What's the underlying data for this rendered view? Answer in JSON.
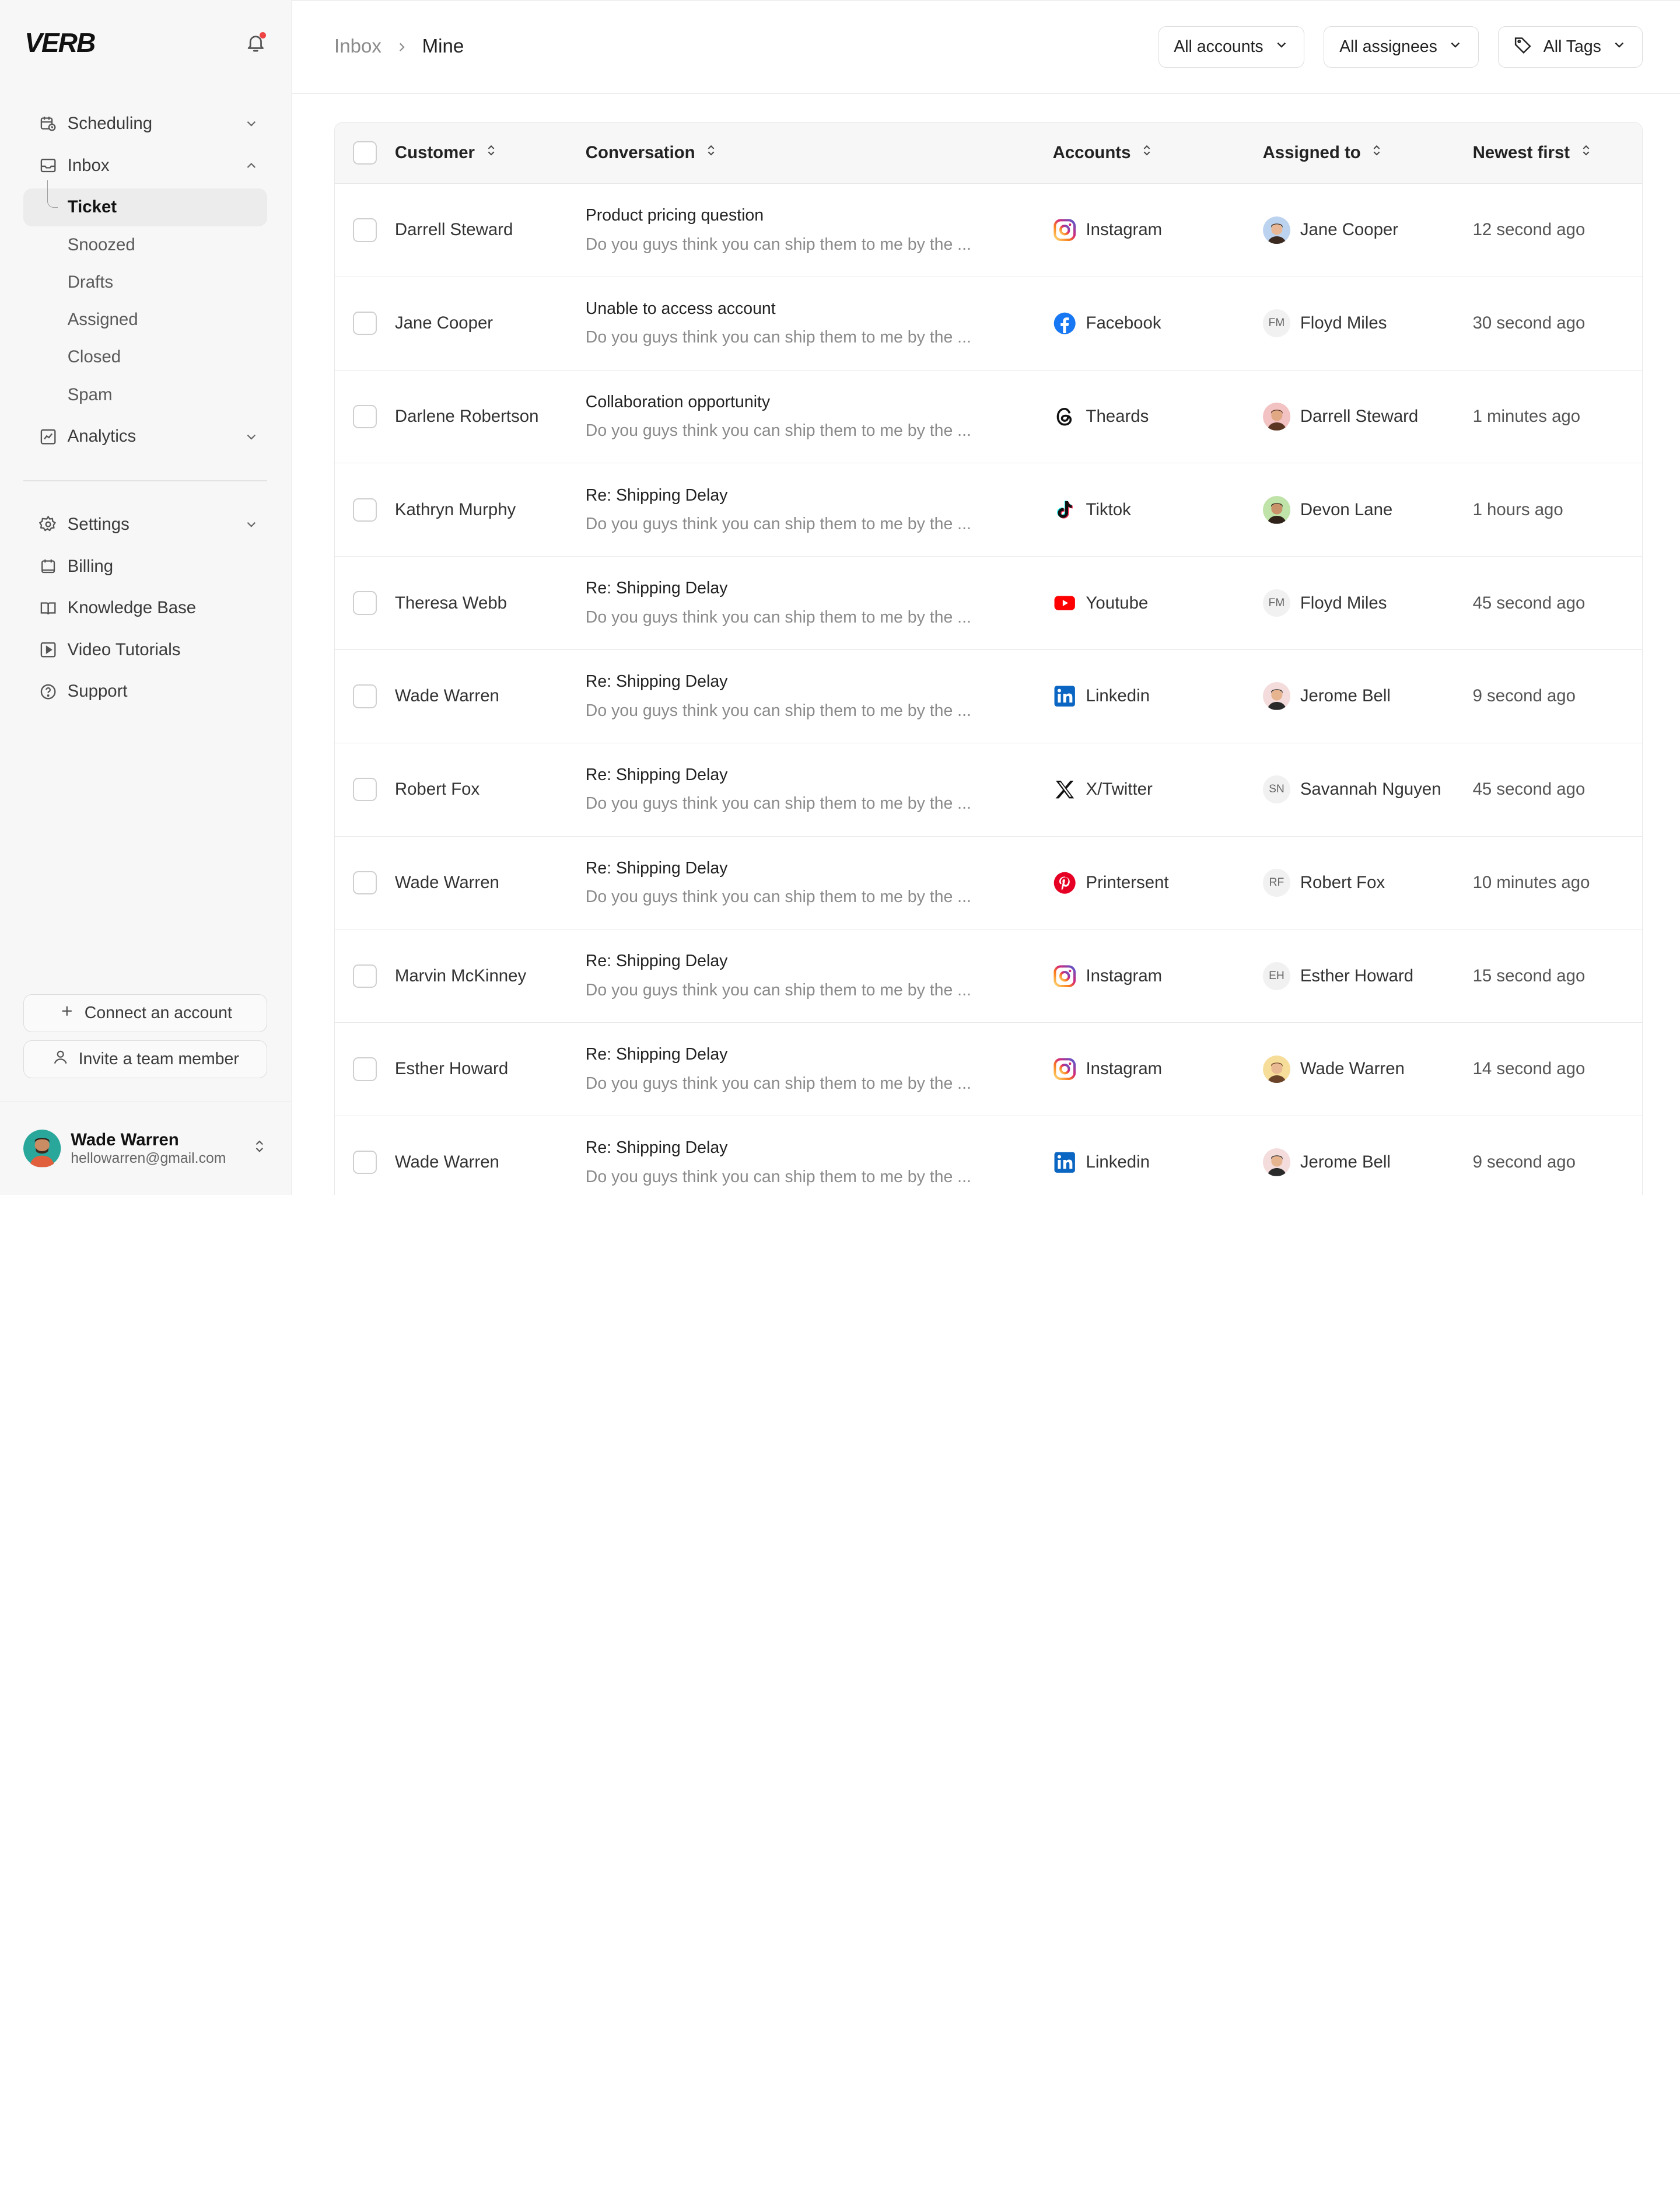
{
  "app": {
    "logo": "VERB"
  },
  "sidebar": {
    "nav": [
      {
        "label": "Scheduling",
        "icon": "calendar-clock-icon",
        "expanded": false
      },
      {
        "label": "Inbox",
        "icon": "inbox-icon",
        "expanded": true
      },
      {
        "label": "Analytics",
        "icon": "chart-icon",
        "expanded": false
      }
    ],
    "inbox_sub": [
      "Ticket",
      "Snoozed",
      "Drafts",
      "Assigned",
      "Closed",
      "Spam"
    ],
    "active_sub": "Ticket",
    "secondary": [
      {
        "label": "Settings",
        "icon": "gear-icon",
        "has_chevron": true
      },
      {
        "label": "Billing",
        "icon": "billing-icon",
        "has_chevron": false
      },
      {
        "label": "Knowledge Base",
        "icon": "book-icon",
        "has_chevron": false
      },
      {
        "label": "Video Tutorials",
        "icon": "video-icon",
        "has_chevron": false
      },
      {
        "label": "Support",
        "icon": "help-icon",
        "has_chevron": false
      }
    ],
    "connect_label": "Connect an account",
    "invite_label": "Invite a team member",
    "user": {
      "name": "Wade Warren",
      "email": "hellowarren@gmail.com"
    }
  },
  "breadcrumb": {
    "parent": "Inbox",
    "current": "Mine"
  },
  "filters": {
    "accounts": "All accounts",
    "assignees": "All assignees",
    "tags": "All Tags"
  },
  "table": {
    "headers": {
      "customer": "Customer",
      "conversation": "Conversation",
      "accounts": "Accounts",
      "assigned": "Assigned to",
      "sort": "Newest first"
    },
    "rows": [
      {
        "customer": "Darrell Steward",
        "title": "Product pricing question",
        "preview": "Do you guys think you can ship them to me by the ...",
        "account": "Instagram",
        "account_icon": "instagram",
        "assignee": "Jane Cooper",
        "avatar": {
          "type": "photo",
          "bg": "#bcd3ef",
          "skin": "#e8b896",
          "hair": "#3a2a20"
        },
        "time": "12 second ago"
      },
      {
        "customer": "Jane Cooper",
        "title": "Unable to access account",
        "preview": "Do you guys think you can ship them to me by the ...",
        "account": "Facebook",
        "account_icon": "facebook",
        "assignee": "Floyd Miles",
        "avatar": {
          "type": "initials",
          "text": "FM"
        },
        "time": "30 second ago"
      },
      {
        "customer": "Darlene Robertson",
        "title": "Collaboration opportunity",
        "preview": "Do you guys think you can ship them to me by the ...",
        "account": "Theards",
        "account_icon": "threads",
        "assignee": "Darrell Steward",
        "avatar": {
          "type": "photo",
          "bg": "#f3c2c2",
          "skin": "#e0a883",
          "hair": "#5a3522"
        },
        "time": "1 minutes ago"
      },
      {
        "customer": "Kathryn Murphy",
        "title": "Re: Shipping Delay",
        "preview": "Do you guys think you can ship them to me by the ...",
        "account": "Tiktok",
        "account_icon": "tiktok",
        "assignee": "Devon Lane",
        "avatar": {
          "type": "photo",
          "bg": "#bfe3a8",
          "skin": "#c8926a",
          "hair": "#2e2219"
        },
        "time": "1 hours ago"
      },
      {
        "customer": "Theresa Webb",
        "title": "Re: Shipping Delay",
        "preview": "Do you guys think you can ship them to me by the ...",
        "account": "Youtube",
        "account_icon": "youtube",
        "assignee": "Floyd Miles",
        "avatar": {
          "type": "initials",
          "text": "FM"
        },
        "time": "45 second ago"
      },
      {
        "customer": "Wade Warren",
        "title": "Re: Shipping Delay",
        "preview": "Do you guys think you can ship them to me by the ...",
        "account": "Linkedin",
        "account_icon": "linkedin",
        "assignee": "Jerome Bell",
        "avatar": {
          "type": "photo",
          "bg": "#f4dcdc",
          "skin": "#e6b48f",
          "hair": "#2a2a2a"
        },
        "time": "9 second ago"
      },
      {
        "customer": "Robert Fox",
        "title": "Re: Shipping Delay",
        "preview": "Do you guys think you can ship them to me by the ...",
        "account": "X/Twitter",
        "account_icon": "x",
        "assignee": "Savannah Nguyen",
        "avatar": {
          "type": "initials",
          "text": "SN"
        },
        "time": "45 second ago"
      },
      {
        "customer": "Wade Warren",
        "title": "Re: Shipping Delay",
        "preview": "Do you guys think you can ship them to me by the ...",
        "account": "Printersent",
        "account_icon": "pinterest",
        "assignee": "Robert Fox",
        "avatar": {
          "type": "initials",
          "text": "RF"
        },
        "time": "10 minutes ago"
      },
      {
        "customer": "Marvin McKinney",
        "title": "Re: Shipping Delay",
        "preview": "Do you guys think you can ship them to me by the ...",
        "account": "Instagram",
        "account_icon": "instagram",
        "assignee": "Esther Howard",
        "avatar": {
          "type": "initials",
          "text": "EH"
        },
        "time": "15 second ago"
      },
      {
        "customer": "Esther Howard",
        "title": "Re: Shipping Delay",
        "preview": "Do you guys think you can ship them to me by the ...",
        "account": "Instagram",
        "account_icon": "instagram",
        "assignee": "Wade Warren",
        "avatar": {
          "type": "photo",
          "bg": "#f7dd9a",
          "skin": "#e9b993",
          "hair": "#6a4328"
        },
        "time": "14 second ago"
      },
      {
        "customer": "Wade Warren",
        "title": "Re: Shipping Delay",
        "preview": "Do you guys think you can ship them to me by the ...",
        "account": "Linkedin",
        "account_icon": "linkedin",
        "assignee": "Jerome Bell",
        "avatar": {
          "type": "photo",
          "bg": "#f4dcdc",
          "skin": "#e6b48f",
          "hair": "#2a2a2a"
        },
        "time": "9 second ago"
      }
    ]
  }
}
